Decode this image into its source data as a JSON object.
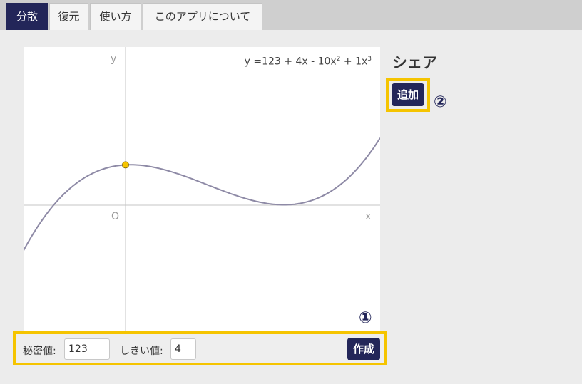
{
  "tabs": [
    {
      "label": "分散",
      "active": true
    },
    {
      "label": "復元",
      "active": false
    },
    {
      "label": "使い方",
      "active": false
    },
    {
      "label": "このアプリについて",
      "active": false
    }
  ],
  "graph": {
    "y_axis_label": "y",
    "x_axis_label": "x",
    "origin_label": "O",
    "equation": {
      "prefix": "y =123 + 4x - 10x",
      "exp1": "2",
      "middle": " + 1x",
      "exp2": "3"
    },
    "coefficients": [
      123,
      4,
      -10,
      1
    ]
  },
  "form": {
    "secret_label": "秘密値:",
    "secret_value": "123",
    "threshold_label": "しきい値:",
    "threshold_value": "4",
    "create_button": "作成",
    "marker_1": "①"
  },
  "share": {
    "title": "シェア",
    "add_button": "追加",
    "marker_2": "②"
  },
  "colors": {
    "accent": "#232659",
    "highlight": "#f5c400",
    "curve": "#8e8aa6",
    "point": "#f5c400"
  }
}
